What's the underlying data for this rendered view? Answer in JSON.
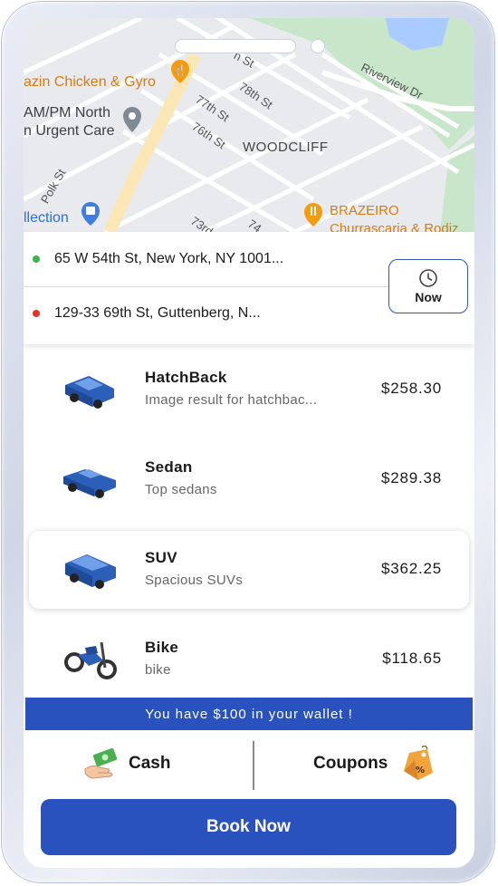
{
  "map": {
    "street_labels": [
      "n St",
      "78th St",
      "77th St",
      "76th St",
      "Polk St",
      "73rd",
      "74",
      "Riverview Dr"
    ],
    "area_label": "WOODCLIFF",
    "pois": [
      {
        "label": "azin Chicken & Gyro",
        "icon": "restaurant-pin-icon"
      },
      {
        "label": "AM/PM North",
        "icon": "medical-pin-icon"
      },
      {
        "label": "n Urgent Care",
        "icon": "medical-pin-icon"
      },
      {
        "label": "llection",
        "icon": "shopping-pin-icon"
      },
      {
        "label": "BRAZEIRO",
        "icon": "restaurant-pin-icon"
      },
      {
        "label": "Churrascaria & Rodiz",
        "icon": "restaurant-pin-icon"
      }
    ]
  },
  "trip": {
    "pickup": "65 W 54th St, New York, NY 1001...",
    "drop": "129-33 69th St, Guttenberg, N...",
    "time_button": {
      "label": "Now",
      "icon": "clock-icon"
    }
  },
  "vehicles": [
    {
      "name": "HatchBack",
      "description": "Image result for hatchbac...",
      "price": "$258.30",
      "icon": "hatchback-car-icon",
      "selected": false
    },
    {
      "name": "Sedan",
      "description": "Top sedans",
      "price": "$289.38",
      "icon": "sedan-car-icon",
      "selected": false
    },
    {
      "name": "SUV",
      "description": "Spacious SUVs",
      "price": "$362.25",
      "icon": "suv-car-icon",
      "selected": true
    },
    {
      "name": "Bike",
      "description": "bike",
      "price": "$118.65",
      "icon": "motorbike-icon",
      "selected": false
    }
  ],
  "wallet": {
    "message": "You have $100 in your wallet !"
  },
  "payment": {
    "cash_label": "Cash",
    "coupons_label": "Coupons"
  },
  "book_button": {
    "label": "Book Now"
  },
  "colors": {
    "primary": "#2a52be",
    "pickup_dot": "#3bb54a",
    "drop_dot": "#e0342b",
    "map_park": "#c8e6c9",
    "map_water": "#aacbff"
  }
}
